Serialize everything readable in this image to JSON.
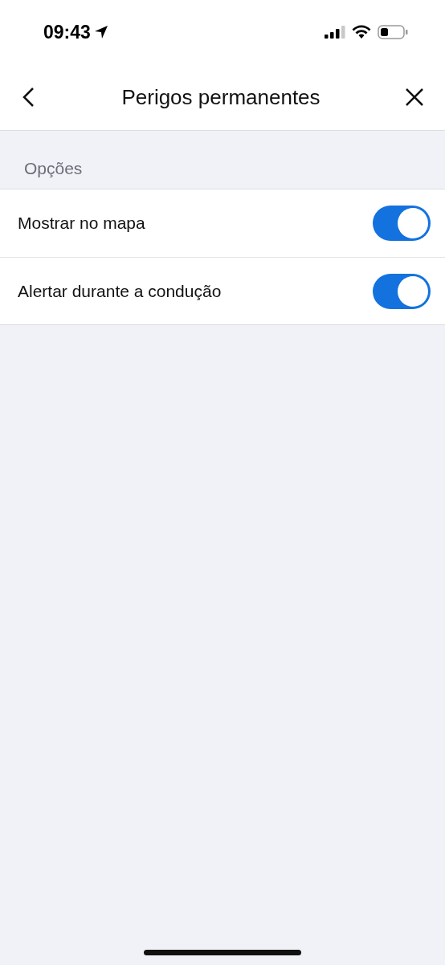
{
  "status_bar": {
    "time": "09:43"
  },
  "nav": {
    "title": "Perigos permanentes"
  },
  "section": {
    "header": "Opções"
  },
  "rows": [
    {
      "label": "Mostrar no mapa",
      "on": true
    },
    {
      "label": "Alertar durante a condução",
      "on": true
    }
  ]
}
